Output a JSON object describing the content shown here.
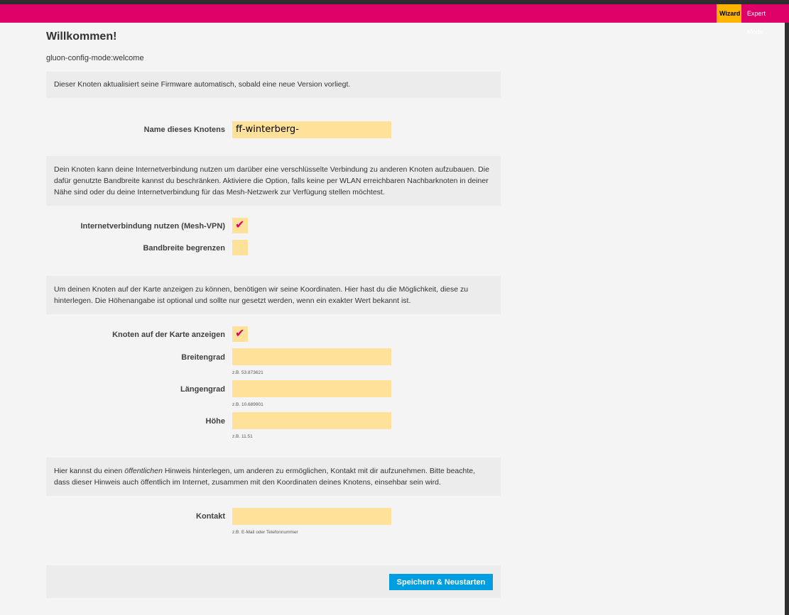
{
  "topbar": {
    "tabs": [
      {
        "label": "Wizard",
        "active": true
      },
      {
        "label": "Expert Mode",
        "active": false
      }
    ]
  },
  "page": {
    "title": "Willkommen!",
    "subtitle": "gluon-config-mode:welcome"
  },
  "info": {
    "autoupdate": "Dieser Knoten aktualisiert seine Firmware automatisch, sobald eine neue Version vorliegt.",
    "meshvpn": "Dein Knoten kann deine Internetverbindung nutzen um darüber eine verschlüsselte Verbindung zu anderen Knoten aufzubauen. Die dafür genutzte Bandbreite kannst du beschränken. Aktiviere die Option, falls keine per WLAN erreichbaren Nachbarknoten in deiner Nähe sind oder du deine Internetverbindung für das Mesh-Netzwerk zur Verfügung stellen möchtest.",
    "location": "Um deinen Knoten auf der Karte anzeigen zu können, benötigen wir seine Koordinaten. Hier hast du die Möglichkeit, diese zu hinterlegen. Die Höhenangabe ist optional und sollte nur gesetzt werden, wenn ein exakter Wert bekannt ist.",
    "contact_before": "Hier kannst du einen ",
    "contact_em": "öffentlichen",
    "contact_after": " Hinweis hinterlegen, um anderen zu ermöglichen, Kontakt mit dir aufzunehmen. Bitte beachte, dass dieser Hinweis auch öffentlich im Internet, zusammen mit den Koordinaten deines Knotens, einsehbar sein wird."
  },
  "fields": {
    "hostname": {
      "label": "Name dieses Knotens",
      "value": "ff-winterberg-"
    },
    "meshvpn": {
      "label": "Internetverbindung nutzen (Mesh-VPN)",
      "checked": true,
      "mark": "✔"
    },
    "limit": {
      "label": "Bandbreite begrenzen",
      "checked": false
    },
    "showmap": {
      "label": "Knoten auf der Karte anzeigen",
      "checked": true,
      "mark": "✔"
    },
    "latitude": {
      "label": "Breitengrad",
      "value": "",
      "hint": "z.B. 53.873621"
    },
    "longitude": {
      "label": "Längengrad",
      "value": "",
      "hint": "z.B. 10.689901"
    },
    "altitude": {
      "label": "Höhe",
      "value": "",
      "hint": "z.B. 11.51"
    },
    "contact": {
      "label": "Kontakt",
      "value": "",
      "hint": "z.B. E-Mail oder Telefonnummer"
    }
  },
  "actions": {
    "save_label": "Speichern & Neustarten"
  },
  "colors": {
    "accent": "#dc0067",
    "active_tab": "#ffb400",
    "input_bg": "#ffe199",
    "button": "#009ee0"
  }
}
